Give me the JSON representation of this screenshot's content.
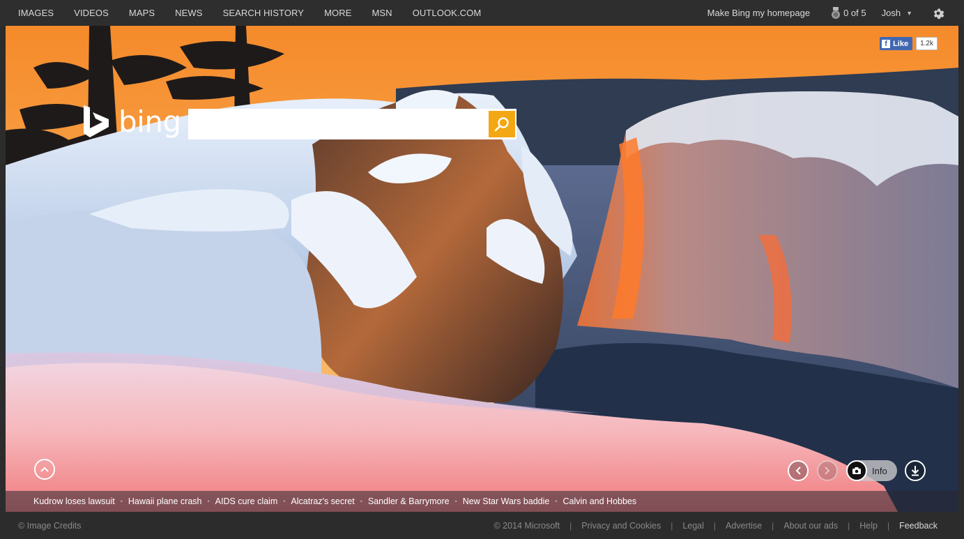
{
  "nav": {
    "left": [
      "IMAGES",
      "VIDEOS",
      "MAPS",
      "NEWS",
      "SEARCH HISTORY",
      "MORE",
      "MSN",
      "OUTLOOK.COM"
    ],
    "homepage_link": "Make Bing my homepage",
    "rewards": "0 of 5",
    "user": "Josh",
    "icons": {
      "rewards": "medal-icon",
      "settings": "gear-icon",
      "caret": "chevron-down-icon"
    }
  },
  "facebook": {
    "like_label": "Like",
    "count": "1.2k"
  },
  "logo": {
    "word": "bing"
  },
  "search": {
    "value": "",
    "placeholder": "",
    "icon": "search-icon"
  },
  "controls": {
    "info_label": "Info"
  },
  "news": [
    "Kudrow loses lawsuit",
    "Hawaii plane crash",
    "AIDS cure claim",
    "Alcatraz's secret",
    "Sandler & Barrymore",
    "New Star Wars baddie",
    "Calvin and Hobbes"
  ],
  "footer": {
    "credits": "© Image Credits",
    "links": [
      "© 2014 Microsoft",
      "Privacy and Cookies",
      "Legal",
      "Advertise",
      "About our ads",
      "Help"
    ],
    "feedback": "Feedback"
  },
  "colors": {
    "search_button": "#f3a713",
    "topbar": "#2e2e2e",
    "facebook": "#4267b2"
  }
}
